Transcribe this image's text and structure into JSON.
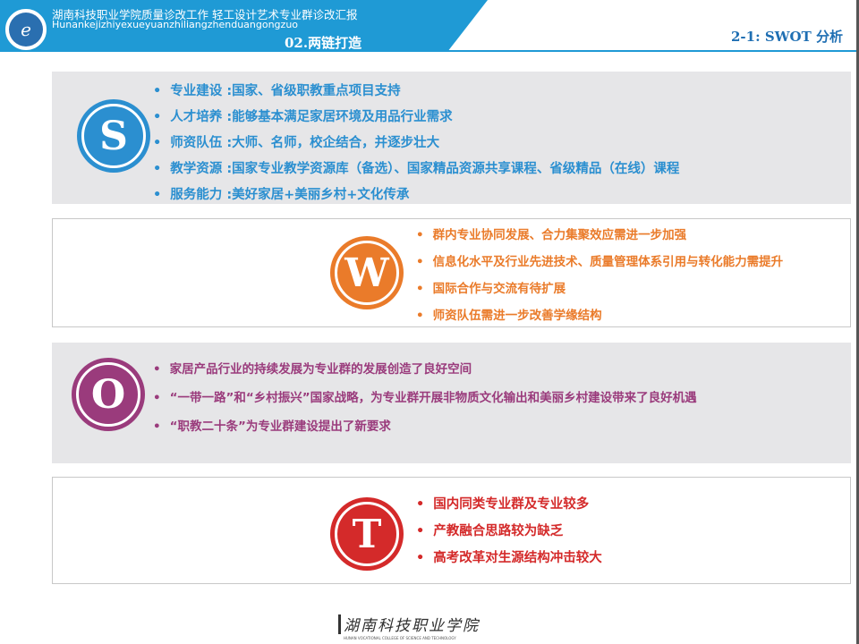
{
  "header": {
    "title_line": "湖南科技职业学院质量诊改工作    轻工设计艺术专业群诊改汇报",
    "pinyin_line": "Hunankejizhiyexueyuanzhiliangzhenduangongzuo",
    "chapter": "02.两链打造",
    "section": "2-1: SWOT 分析",
    "logo_glyph": "e"
  },
  "colors": {
    "header_blue": "#1f9ad5",
    "s": "#2b8fd0",
    "w": "#ea7b2a",
    "o": "#9a3b7c",
    "t": "#d42a2a"
  },
  "swot": {
    "s": {
      "letter": "S",
      "items": [
        "专业建设 :国家、省级职教重点项目支持",
        "人才培养 :能够基本满足家居环境及用品行业需求",
        "师资队伍 :大师、名师，校企结合，并逐步壮大",
        "教学资源 :国家专业教学资源库（备选）、国家精品资源共享课程、省级精品（在线）课程",
        "服务能力 :美好家居+美丽乡村+文化传承"
      ]
    },
    "w": {
      "letter": "W",
      "items": [
        "群内专业协同发展、合力集聚效应需进一步加强",
        "信息化水平及行业先进技术、质量管理体系引用与转化能力需提升",
        "国际合作与交流有待扩展",
        "师资队伍需进一步改善学缘结构"
      ]
    },
    "o": {
      "letter": "O",
      "items": [
        "家居产品行业的持续发展为专业群的发展创造了良好空间",
        "“一带一路”和“乡村振兴”国家战略，为专业群开展非物质文化输出和美丽乡村建设带来了良好机遇",
        "“职教二十条”为专业群建设提出了新要求"
      ]
    },
    "t": {
      "letter": "T",
      "items": [
        "国内同类专业群及专业较多",
        "产教融合思路较为缺乏",
        "高考改革对生源结构冲击较大"
      ]
    }
  },
  "footer": {
    "college_name": "湖南科技职业学院",
    "college_name_en": "HUNAN VOCATIONAL COLLEGE OF SCIENCE AND TECHNOLOGY"
  }
}
